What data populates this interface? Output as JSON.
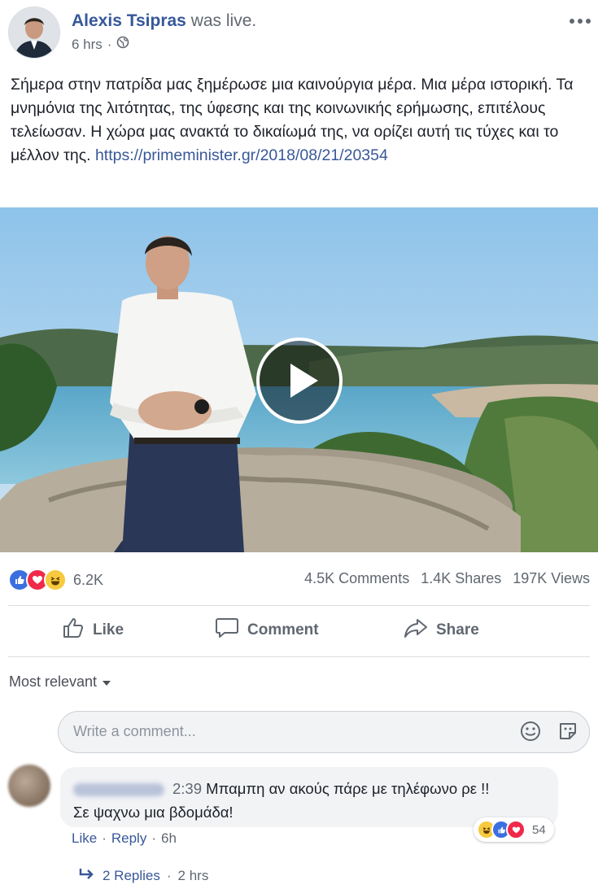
{
  "post": {
    "author": "Alexis Tsipras",
    "status": "was live.",
    "time": "6 hrs",
    "separator": "·",
    "text": "Σήμερα στην πατρίδα μας ξημέρωσε μια καινούργια μέρα. Μια μέρα ιστορική. Τα μνημόνια της λιτότητας, της ύφεσης και της κοινωνικής ερήμωσης, επιτέλους τελείωσαν. Η χώρα μας ανακτά το δικαίωμά της, να ορίζει αυτή τις τύχες και το μέλλον της.",
    "link": "https://primeminister.gr/2018/08/21/20354"
  },
  "stats": {
    "reactions_count": "6.2K",
    "comments": "4.5K Comments",
    "shares": "1.4K Shares",
    "views": "197K Views"
  },
  "actions": {
    "like": "Like",
    "comment": "Comment",
    "share": "Share"
  },
  "comments_section": {
    "sort_label": "Most relevant",
    "input_placeholder": "Write a comment...",
    "comment": {
      "timestamp": "2:39",
      "text_line1": "Μπαμπη αν ακούς πάρε με τηλέφωνο ρε !!",
      "text_line2": "Σε ψαχνω μια βδομάδα!",
      "reaction_count": "54",
      "like_label": "Like",
      "reply_label": "Reply",
      "age": "6h",
      "dot": "·"
    },
    "replies": {
      "label": "2 Replies",
      "age": "2 hrs",
      "dot": "·"
    }
  },
  "colors": {
    "link": "#385898",
    "author": "#365899",
    "like_blue": "#3b6fe0",
    "love_red": "#f0284a",
    "haha_yellow": "#f7c93e"
  }
}
